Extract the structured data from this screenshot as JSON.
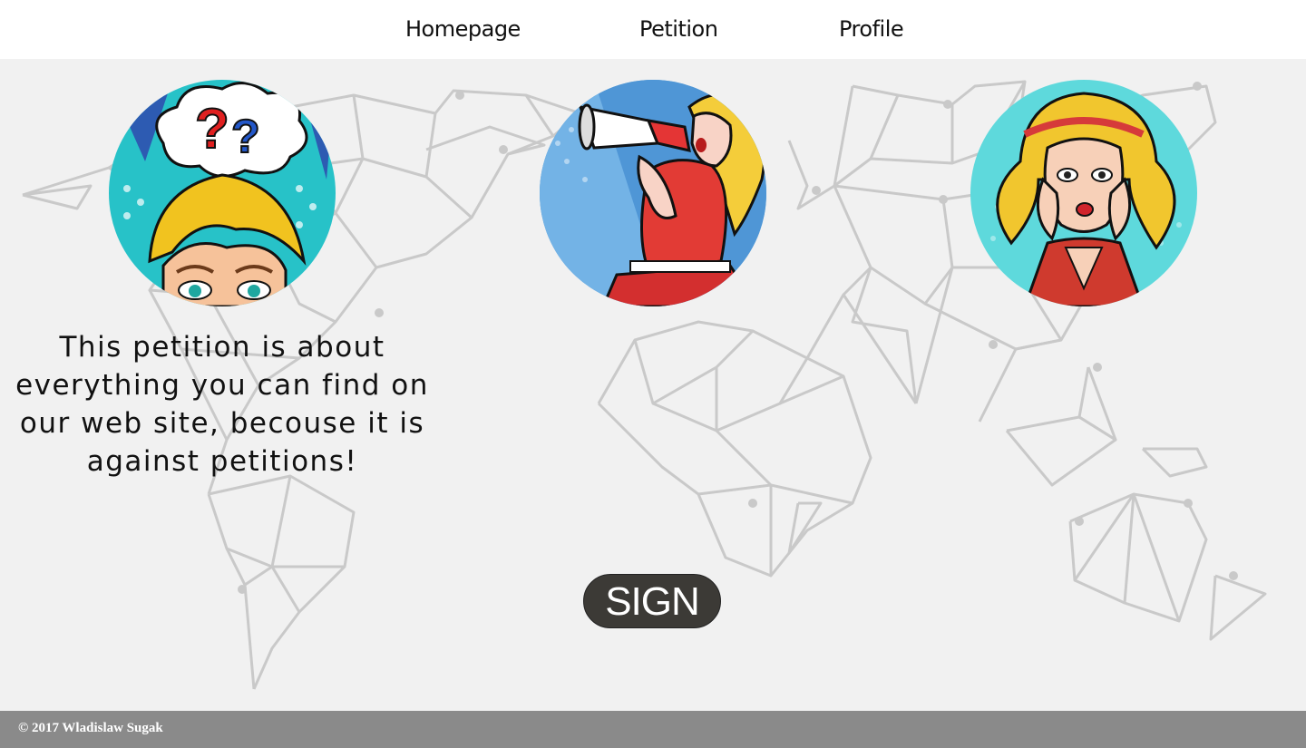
{
  "nav": {
    "items": [
      {
        "label": "Homepage"
      },
      {
        "label": "Petition"
      },
      {
        "label": "Profile"
      }
    ]
  },
  "main": {
    "petition_text": "This petition is about everything you can find on our web site, becouse it is against petitions!",
    "sign_label": "SIGN",
    "avatars": [
      {
        "icon": "confused-woman-pop-art-icon"
      },
      {
        "icon": "megaphone-woman-pop-art-icon"
      },
      {
        "icon": "shocked-woman-pop-art-icon"
      }
    ]
  },
  "footer": {
    "copyright": "© 2017 Wladislaw Sugak"
  },
  "colors": {
    "button_bg": "#3c3a36",
    "footer_bg": "#8a8a8a",
    "map_lines": "#c6c6c6"
  }
}
